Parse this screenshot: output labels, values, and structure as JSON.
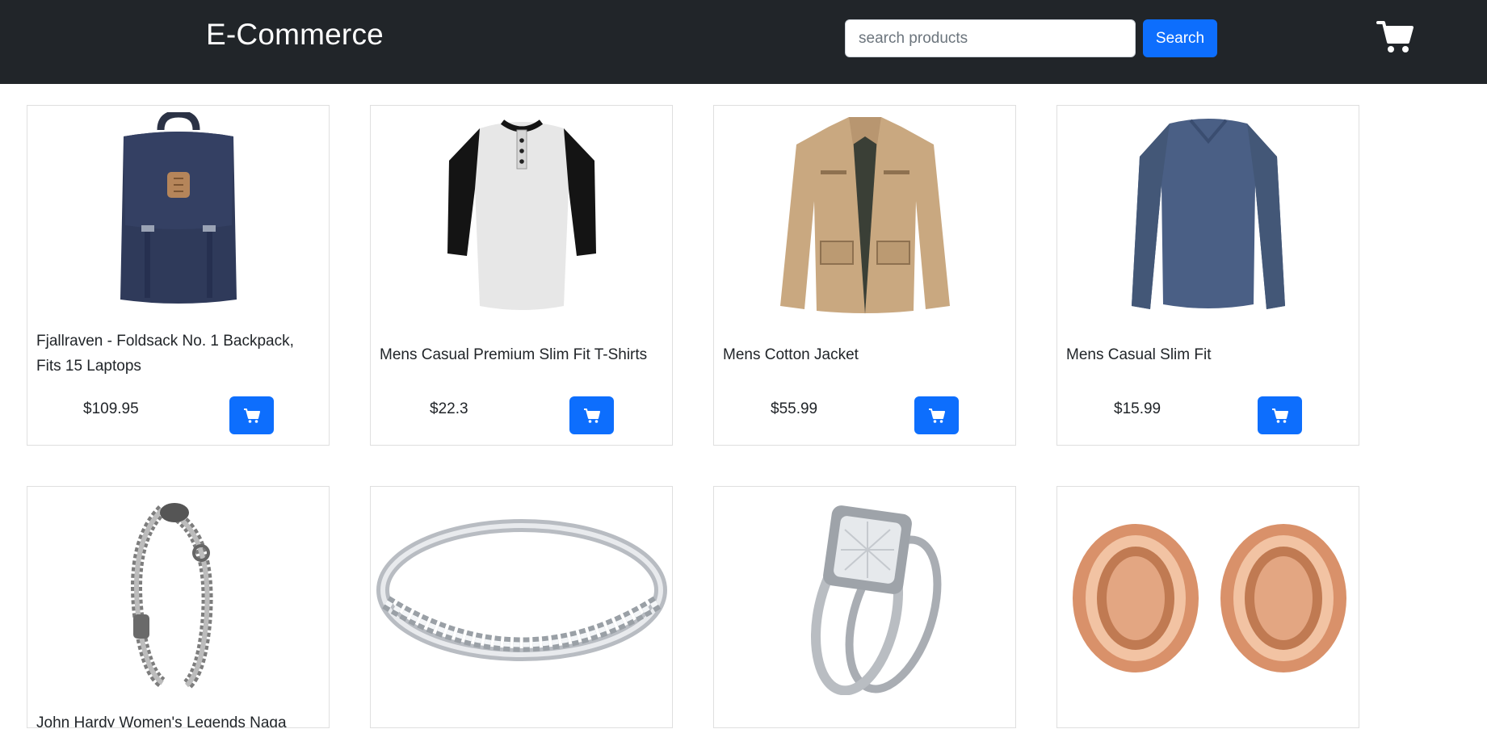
{
  "navbar": {
    "brand": "E-Commerce",
    "search_placeholder": "search products",
    "search_label": "Search",
    "cart_icon": "shopping-cart-icon"
  },
  "products": [
    {
      "title": "Fjallraven - Foldsack No. 1 Backpack, Fits 15 Laptops",
      "price": "$109.95",
      "image": "backpack"
    },
    {
      "title": "Mens Casual Premium Slim Fit T-Shirts",
      "price": "$22.3",
      "image": "t-shirt"
    },
    {
      "title": "Mens Cotton Jacket",
      "price": "$55.99",
      "image": "jacket"
    },
    {
      "title": "Mens Casual Slim Fit",
      "price": "$15.99",
      "image": "long-sleeve-shirt"
    },
    {
      "title": "John Hardy Women's Legends Naga",
      "price": "",
      "image": "chain-bracelet"
    },
    {
      "title": "",
      "price": "",
      "image": "silver-band-ring"
    },
    {
      "title": "",
      "price": "",
      "image": "diamond-ring-set"
    },
    {
      "title": "",
      "price": "",
      "image": "rose-gold-plugs"
    }
  ],
  "colors": {
    "navbar_bg": "#212529",
    "primary": "#0d6efd",
    "text": "#212529"
  }
}
